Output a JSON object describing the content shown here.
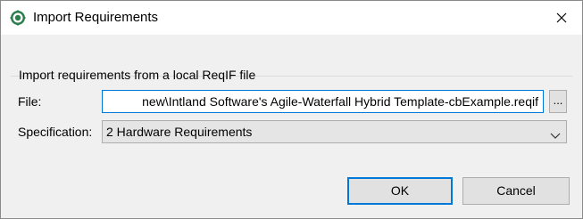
{
  "window": {
    "title": "Import Requirements",
    "app_icon": "settings-gear-icon",
    "close_icon": "close-icon"
  },
  "group": {
    "label": "Import requirements from a local ReqIF file"
  },
  "file": {
    "label": "File:",
    "value": "new\\Intland Software's Agile-Waterfall Hybrid Template-cbExample.reqif",
    "browse_label": "..."
  },
  "specification": {
    "label": "Specification:",
    "selected": "2 Hardware Requirements"
  },
  "buttons": {
    "ok": "OK",
    "cancel": "Cancel"
  },
  "colors": {
    "accent": "#0078d7",
    "dialog_bg": "#f0f0f0",
    "button_bg": "#e1e1e1"
  }
}
